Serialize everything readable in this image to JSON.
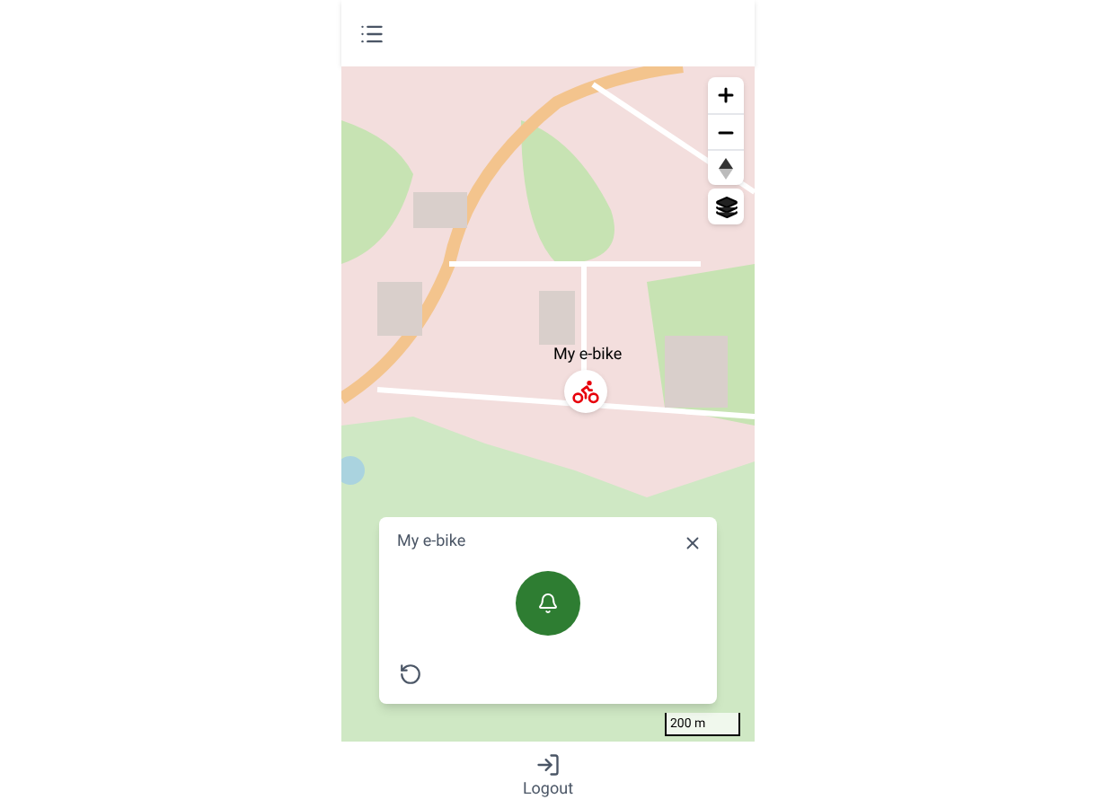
{
  "marker": {
    "label": "My e-bike"
  },
  "scale": {
    "label": "200 m"
  },
  "popup": {
    "title": "My e-bike"
  },
  "bottom_nav": {
    "label": "Logout"
  }
}
